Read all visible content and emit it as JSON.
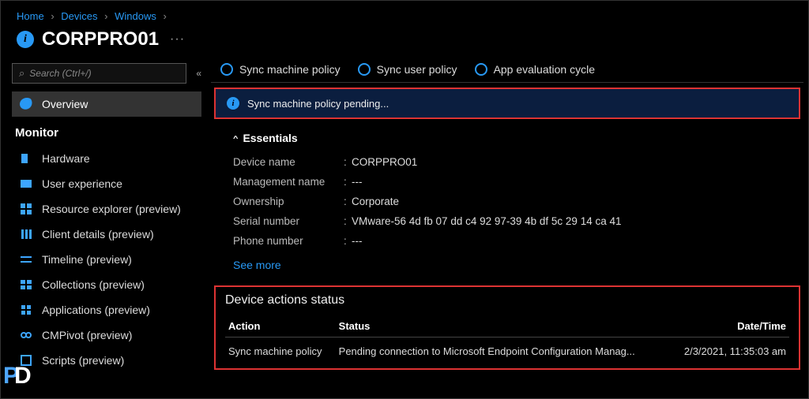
{
  "breadcrumb": {
    "home": "Home",
    "devices": "Devices",
    "windows": "Windows"
  },
  "page_title": "CORPPRO01",
  "search_placeholder": "Search (Ctrl+/)",
  "sidebar": {
    "overview": "Overview",
    "monitor_header": "Monitor",
    "items": [
      "Hardware",
      "User experience",
      "Resource explorer (preview)",
      "Client details (preview)",
      "Timeline (preview)",
      "Collections (preview)",
      "Applications (preview)",
      "CMPivot (preview)",
      "Scripts (preview)"
    ]
  },
  "toolbar": {
    "sync_machine": "Sync machine policy",
    "sync_user": "Sync user policy",
    "app_eval": "App evaluation cycle"
  },
  "notice": "Sync machine policy pending...",
  "essentials": {
    "header": "Essentials",
    "rows": [
      {
        "label": "Device name",
        "value": "CORPPRO01"
      },
      {
        "label": "Management name",
        "value": "---"
      },
      {
        "label": "Ownership",
        "value": "Corporate"
      },
      {
        "label": "Serial number",
        "value": "VMware-56 4d fb 07 dd c4 92 97-39 4b df 5c 29 14 ca 41"
      },
      {
        "label": "Phone number",
        "value": "---"
      }
    ],
    "see_more": "See more"
  },
  "actions": {
    "title": "Device actions status",
    "cols": {
      "action": "Action",
      "status": "Status",
      "dt": "Date/Time"
    },
    "rows": [
      {
        "action": "Sync machine policy",
        "status": "Pending connection to Microsoft Endpoint Configuration Manag...",
        "dt": "2/3/2021, 11:35:03 am"
      }
    ]
  }
}
